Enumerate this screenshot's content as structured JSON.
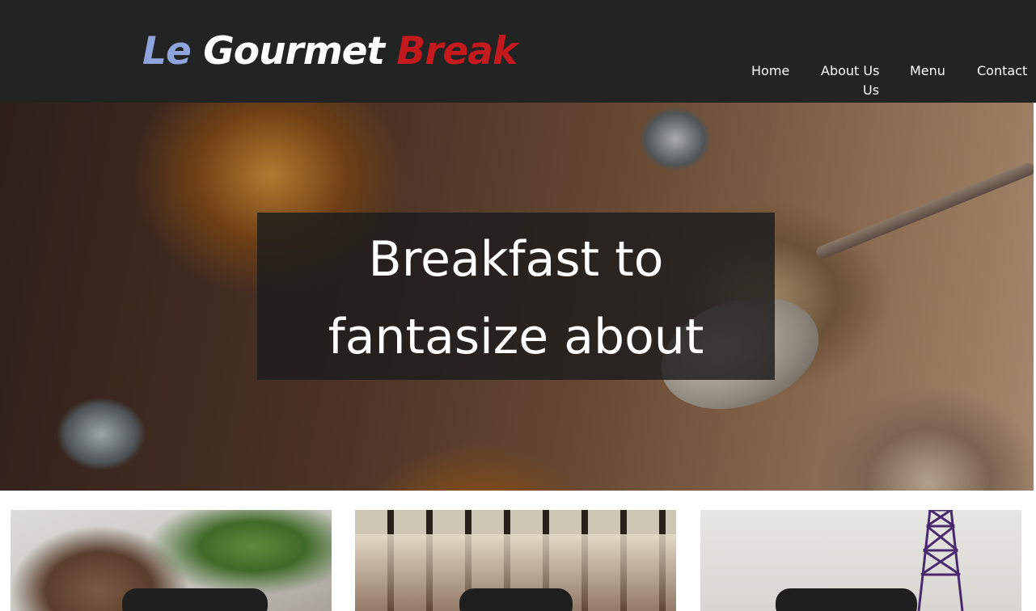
{
  "header": {
    "logo": {
      "word1": "Le",
      "word2": "Gourmet",
      "word3": "Break"
    },
    "nav": {
      "home": "Home",
      "about_line1": "About Us",
      "about_line2": "Us",
      "menu": "Menu",
      "contact": "Contact"
    }
  },
  "hero": {
    "line1": "Breakfast to",
    "line2": "fantasize about"
  },
  "colors": {
    "header_bg": "#222424",
    "logo_blue": "#8fa4dc",
    "logo_white": "#ffffff",
    "logo_red": "#c41a1d",
    "hero_overlay": "#1c1c1c"
  },
  "icons": {
    "cards": [
      "crepe-salad-photo",
      "wine-bottles-photo",
      "eiffel-tower-photo"
    ]
  }
}
